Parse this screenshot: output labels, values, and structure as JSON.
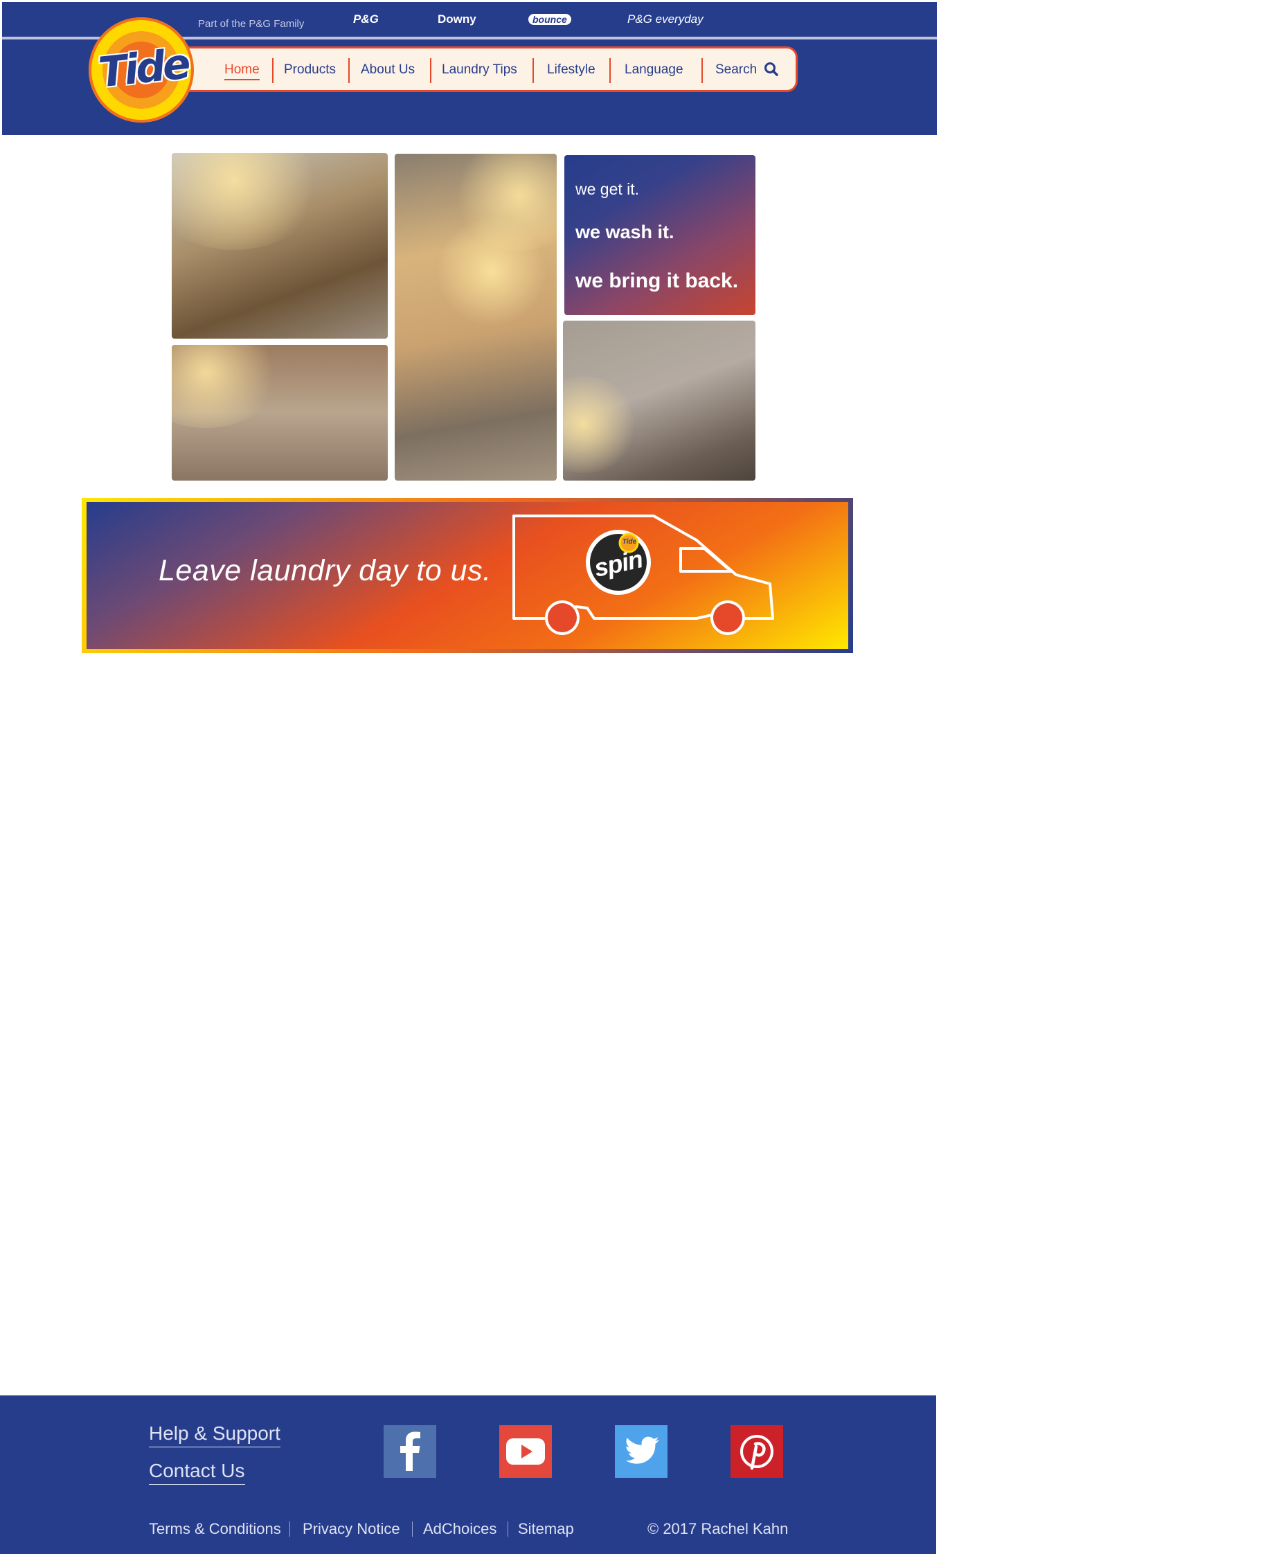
{
  "header": {
    "family_label": "Part of the P&G Family",
    "brands": [
      "P&G",
      "Downy",
      "bounce",
      "P&G everyday"
    ],
    "logo_text": "Tide"
  },
  "nav": {
    "items": [
      {
        "label": "Home",
        "active": true
      },
      {
        "label": "Products"
      },
      {
        "label": "About Us"
      },
      {
        "label": "Laundry Tips"
      },
      {
        "label": "Lifestyle"
      },
      {
        "label": "Language"
      },
      {
        "label": "Search"
      }
    ],
    "search_icon": "magnifier-icon"
  },
  "hero": {
    "taglines": [
      "we get it.",
      "we wash it.",
      "we bring it back."
    ]
  },
  "banner": {
    "text": "Leave laundry day to us.",
    "badge_text": "spin",
    "badge_brand": "Tide",
    "icon": "delivery-van-icon"
  },
  "footer": {
    "links": [
      "Help & Support",
      "Contact Us"
    ],
    "social": [
      "facebook-icon",
      "youtube-icon",
      "twitter-icon",
      "pinterest-icon"
    ],
    "legal": [
      "Terms & Conditions",
      "Privacy Notice",
      "AdChoices",
      "Sitemap"
    ],
    "copyright": "© 2017 Rachel Kahn"
  },
  "colors": {
    "brand_blue": "#263d8c",
    "accent_orange": "#e5492a",
    "yellow": "#ffe600"
  }
}
